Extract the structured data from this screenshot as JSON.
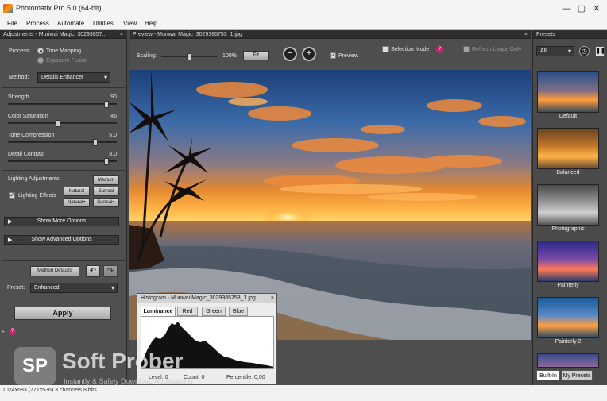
{
  "window": {
    "title": "Photomatix Pro 5.0 (64-bit)",
    "controls": [
      "—",
      "▢",
      "✕"
    ]
  },
  "menu": [
    "File",
    "Process",
    "Automate",
    "Utilities",
    "View",
    "Help"
  ],
  "adjustments": {
    "header": "Adjustments - Muriwai Magic_30293857...",
    "process_label": "Process:",
    "process_options": [
      "Tone Mapping",
      "Exposure Fusion"
    ],
    "process_selected": "Tone Mapping",
    "method_label": "Method:",
    "method_value": "Details Enhancer",
    "sliders": [
      {
        "label": "Strength",
        "value": "90",
        "level": 0.9
      },
      {
        "label": "Color Saturation",
        "value": "46",
        "level": 0.46
      },
      {
        "label": "Tone Compression",
        "value": "6.0",
        "level": 0.8
      },
      {
        "label": "Detail Contrast",
        "value": "8.0",
        "level": 0.9
      }
    ],
    "lighting_title": "Lighting Adjustments",
    "lighting_effects_label": "Lighting Effects",
    "lighting_buttons": [
      "Medium",
      "Natural",
      "Surreal",
      "Natural+",
      "Surreal+"
    ],
    "show_more": "Show More Options",
    "show_advanced": "Show Advanced Options",
    "method_defaults": "Method Defaults",
    "preset_label": "Preset:",
    "preset_value": "Enhanced",
    "apply": "Apply"
  },
  "preview": {
    "header": "Preview - Muriwai Magic_3029385753_1.jpg",
    "scaling_label": "Scaling:",
    "scaling_value": "100%",
    "fit": "Fit",
    "preview_label": "Preview",
    "selection_mode": "Selection Mode",
    "refresh_label": "Refresh Loupe Only"
  },
  "presets": {
    "header": "Presets",
    "filter": "All",
    "items": [
      "Default",
      "Balanced",
      "Photographic",
      "Painterly",
      "Painterly 2"
    ],
    "tabs": [
      "Built-In",
      "My Presets"
    ]
  },
  "histogram": {
    "title": "Histogram - Muriwai Magic_3029385753_1.jpg",
    "tabs": [
      "Luminance",
      "Red",
      "Green",
      "Blue"
    ],
    "level": "Level: 0",
    "count": "Count: 0",
    "percentile": "Percentile: 0,00"
  },
  "watermark": {
    "logo": "SP",
    "name": "Soft Prober",
    "tagline": "Instantly & Safely Download Applications"
  },
  "status": "1024x683 (771x536) 3 channels 8 bits"
}
